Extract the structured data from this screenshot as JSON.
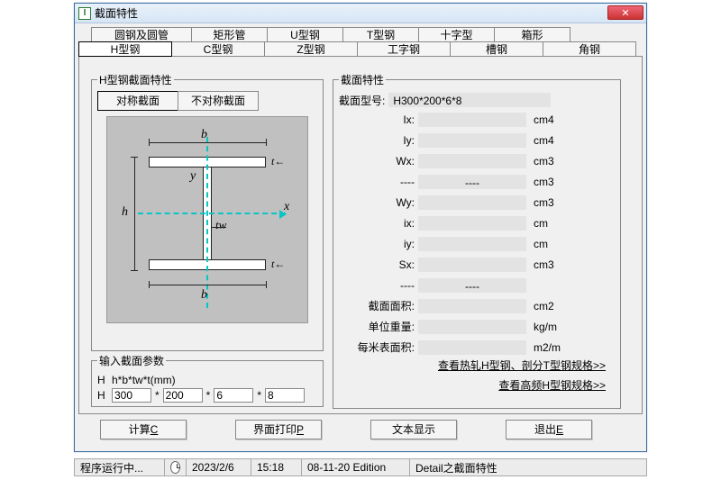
{
  "window": {
    "title": "截面特性"
  },
  "tabs_top": [
    "圆钢及圆管",
    "矩形管",
    "U型钢",
    "T型钢",
    "十字型",
    "箱形"
  ],
  "tabs_bot": [
    "H型钢",
    "C型钢",
    "Z型钢",
    "工字钢",
    "槽钢",
    "角钢"
  ],
  "tabs_bot_selected": 0,
  "group_left_title": "H型钢截面特性",
  "sub_tabs": {
    "a": "对称截面",
    "b": "不对称截面",
    "selected": "a"
  },
  "diagram": {
    "b": "b",
    "y": "y",
    "h": "h",
    "tw": "tw",
    "tf": "t",
    "x": "x"
  },
  "input_group": {
    "title": "输入截面参数",
    "hint_prefix": "H",
    "hint_text": "h*b*tw*t(mm)",
    "row_prefix": "H",
    "h": "300",
    "b": "200",
    "tw": "6",
    "t": "8",
    "sep": "*"
  },
  "props_group": {
    "title": "截面特性",
    "id_label": "截面型号:",
    "id_value": "H300*200*6*8",
    "rows": [
      {
        "label": "Ix:",
        "unit": "cm4",
        "val": ""
      },
      {
        "label": "Iy:",
        "unit": "cm4",
        "val": ""
      },
      {
        "label": "Wx:",
        "unit": "cm3",
        "val": ""
      },
      {
        "label": "----",
        "unit": "cm3",
        "val": "----"
      },
      {
        "label": "Wy:",
        "unit": "cm3",
        "val": ""
      },
      {
        "label": "ix:",
        "unit": "cm",
        "val": ""
      },
      {
        "label": "iy:",
        "unit": "cm",
        "val": ""
      },
      {
        "label": "Sx:",
        "unit": "cm3",
        "val": ""
      },
      {
        "label": "----",
        "unit": "",
        "val": "----"
      },
      {
        "label": "截面面积:",
        "unit": "cm2",
        "val": ""
      },
      {
        "label": "单位重量:",
        "unit": "kg/m",
        "val": ""
      },
      {
        "label": "每米表面积:",
        "unit": "m2/m",
        "val": ""
      }
    ],
    "link1": "查看热轧H型钢、剖分T型钢规格>>",
    "link2": "查看高频H型钢规格>>"
  },
  "buttons": {
    "calc_pre": "计算",
    "calc_acc": "C",
    "print_pre": "界面打印",
    "print_acc": "P",
    "text": "文本显示",
    "exit_pre": "退出",
    "exit_acc": "E"
  },
  "status": {
    "running": "程序运行中...",
    "date": "2023/2/6",
    "time": "15:18",
    "edition": "08-11-20 Edition",
    "detail": "Detail之截面特性"
  }
}
